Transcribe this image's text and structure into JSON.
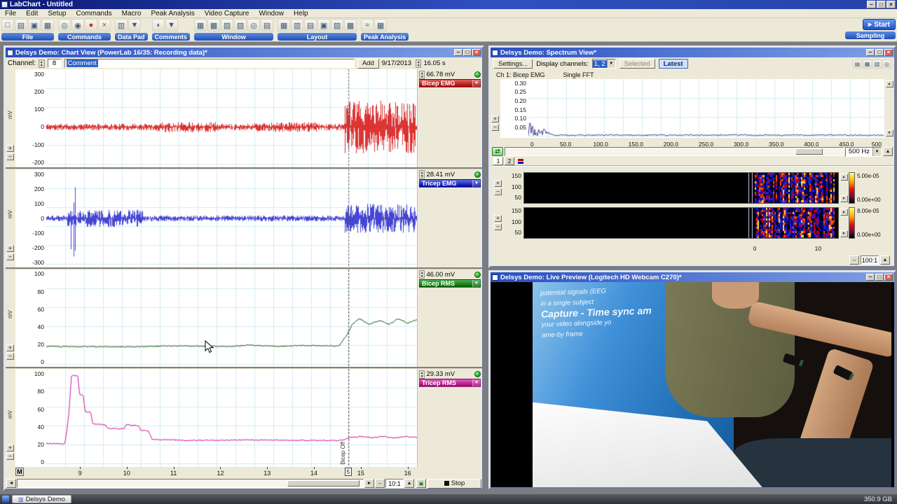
{
  "chrome": {
    "min": "–",
    "max": "□",
    "close": "×"
  },
  "glyphs": {
    "up": "▲",
    "down": "▼",
    "left": "◄",
    "right": "►",
    "both": "↔",
    "dropdown": "▼",
    "start": "▶",
    "refresh": "⇄",
    "screen": "▣"
  },
  "app": {
    "title": "LabChart - Untitled",
    "menus": [
      "File",
      "Edit",
      "Setup",
      "Commands",
      "Macro",
      "Peak Analysis",
      "Video Capture",
      "Window",
      "Help"
    ],
    "toolbar": {
      "groups": [
        {
          "label": "File",
          "icons": [
            "new-file-icon",
            "open-file-icon",
            "save-icon",
            "print-icon"
          ]
        },
        {
          "label": "Commands",
          "icons": [
            "find-icon",
            "zoom-icon",
            "macro-record-icon",
            "delete-icon"
          ]
        },
        {
          "label": "Data Pad",
          "icons": [
            "data-pad-icon",
            "dropdown-icon"
          ]
        },
        {
          "label": "Comments",
          "icons": [
            "comment-icon",
            "dropdown-icon"
          ]
        },
        {
          "label": "Window",
          "icons": [
            "tile-icon",
            "cascade-icon",
            "chart-view-icon",
            "xy-view-icon",
            "zoom-window-icon",
            "notebook-icon"
          ]
        },
        {
          "label": "Layout",
          "icons": [
            "layout-grid-icon",
            "add-row-icon",
            "add-col-icon",
            "merge-icon",
            "split-icon",
            "arrange-icon"
          ]
        },
        {
          "label": "Peak Analysis",
          "icons": [
            "peaks-icon",
            "table-icon"
          ]
        }
      ],
      "start_button": "Start",
      "sampling_label": "Sampling"
    }
  },
  "chart_window": {
    "title": "Delsys Demo: Chart View (PowerLab 16/35: Recording data)*",
    "channel_label": "Channel:",
    "channel_count": "8",
    "comment_text": "Comment",
    "add_button": "Add",
    "date": "9/17/2013",
    "time_value": "16.05 s",
    "marker_block": "M",
    "zoom_ratio": "10:1",
    "stop_button": "Stop",
    "x_axis": {
      "min": 8.28,
      "max": 16.2,
      "ticks": [
        9,
        10,
        11,
        12,
        13,
        14,
        15,
        16
      ]
    },
    "comment_marker": {
      "number": "5",
      "label": "Bicep Off",
      "time": 14.73
    },
    "y_units": [
      "mV",
      "mV",
      "mV",
      "mV"
    ],
    "y_labels": [
      [
        "300",
        "200",
        "100",
        "0",
        "-100",
        "-200"
      ],
      [
        "300",
        "200",
        "100",
        "0",
        "-100",
        "-200",
        "-300"
      ],
      [
        "100",
        "80",
        "60",
        "40",
        "20",
        "0"
      ],
      [
        "100",
        "80",
        "60",
        "40",
        "20",
        "0"
      ]
    ],
    "channels": [
      {
        "name": "Bicep EMG",
        "value": "66.78 mV",
        "bar_from": "#e06060",
        "bar_to": "#a00000"
      },
      {
        "name": "Tricep EMG",
        "value": "28.41 mV",
        "bar_from": "#6070e0",
        "bar_to": "#0000a0"
      },
      {
        "name": "Bicep RMS",
        "value": "46.00 mV",
        "bar_from": "#50b050",
        "bar_to": "#006000"
      },
      {
        "name": "Tricep RMS",
        "value": "29.33 mV",
        "bar_from": "#e05cc0",
        "bar_to": "#a0006c"
      }
    ],
    "signals": [
      {
        "kind": "emg",
        "color": "#d40000",
        "zero": 0.59,
        "base": 0.035,
        "bursts": [
          [
            0.3,
            0.46,
            0.055
          ],
          [
            0.56,
            0.74,
            0.05
          ],
          [
            0.805,
            0.995,
            0.27
          ]
        ]
      },
      {
        "kind": "emg",
        "color": "#1616c8",
        "zero": 0.5,
        "base": 0.03,
        "bursts": [
          [
            0.055,
            0.105,
            0.44
          ],
          [
            0.105,
            0.26,
            0.09
          ],
          [
            0.805,
            0.995,
            0.15
          ]
        ]
      },
      {
        "kind": "rms",
        "color": "#1e5c1e",
        "points": [
          [
            0,
            0.785
          ],
          [
            0.2,
            0.79
          ],
          [
            0.35,
            0.78
          ],
          [
            0.5,
            0.785
          ],
          [
            0.55,
            0.77
          ],
          [
            0.62,
            0.785
          ],
          [
            0.7,
            0.775
          ],
          [
            0.79,
            0.78
          ],
          [
            0.812,
            0.66
          ],
          [
            0.825,
            0.56
          ],
          [
            0.845,
            0.5
          ],
          [
            0.87,
            0.56
          ],
          [
            0.9,
            0.52
          ],
          [
            0.925,
            0.56
          ],
          [
            0.95,
            0.5
          ],
          [
            0.975,
            0.55
          ],
          [
            1,
            0.51
          ]
        ]
      },
      {
        "kind": "rms",
        "color": "#d4149c",
        "points": [
          [
            0,
            0.76
          ],
          [
            0.05,
            0.765
          ],
          [
            0.06,
            0.5
          ],
          [
            0.068,
            0.07
          ],
          [
            0.085,
            0.07
          ],
          [
            0.09,
            0.26
          ],
          [
            0.1,
            0.27
          ],
          [
            0.105,
            0.44
          ],
          [
            0.12,
            0.44
          ],
          [
            0.125,
            0.56
          ],
          [
            0.16,
            0.57
          ],
          [
            0.165,
            0.61
          ],
          [
            0.21,
            0.61
          ],
          [
            0.215,
            0.57
          ],
          [
            0.25,
            0.58
          ],
          [
            0.255,
            0.63
          ],
          [
            0.275,
            0.63
          ],
          [
            0.285,
            0.72
          ],
          [
            0.4,
            0.73
          ],
          [
            0.55,
            0.725
          ],
          [
            0.7,
            0.73
          ],
          [
            0.795,
            0.73
          ],
          [
            0.82,
            0.7
          ],
          [
            0.85,
            0.69
          ],
          [
            0.88,
            0.705
          ],
          [
            0.91,
            0.69
          ],
          [
            0.94,
            0.705
          ],
          [
            0.97,
            0.69
          ],
          [
            1,
            0.7
          ]
        ]
      }
    ]
  },
  "spectrum_window": {
    "title": "Delsys Demo: Spectrum View*",
    "settings_button": "Settings...",
    "display_channels_label": "Display channels:",
    "display_channels_value": "1, 2",
    "selected_button": "Selected",
    "latest_button": "Latest",
    "channel_title": "Ch 1: Bicep EMG",
    "mode": "Single FFT",
    "fft_y_ticks": [
      "0.30",
      "0.25",
      "0.20",
      "0.15",
      "0.10",
      "0.05"
    ],
    "fft_x_ticks": [
      "0",
      "50.0",
      "100.0",
      "150.0",
      "200.0",
      "250.0",
      "300.0",
      "350.0",
      "400.0",
      "450.0",
      "500"
    ],
    "freq_range": "500 Hz",
    "tabs": [
      "1",
      "2"
    ],
    "legend_colors": [
      "#c00000",
      "#0000c0"
    ],
    "spectrograms": [
      {
        "y_ticks": [
          "150",
          "100",
          "50"
        ],
        "scale_max": "5.00e-05",
        "scale_min": "0.00e+00"
      },
      {
        "y_ticks": [
          "150",
          "100",
          "50"
        ],
        "scale_max": "8.00e-05",
        "scale_min": "0.00e+00"
      }
    ],
    "spec_x_ticks": [
      {
        "label": "0",
        "frac": 0.73
      },
      {
        "label": "10",
        "frac": 0.93
      }
    ],
    "zoom_ratio": "100:1"
  },
  "video_window": {
    "title": "Delsys Demo: Live Preview (Logitech HD Webcam C270)*",
    "banner_lines": [
      "potential signals (EEG",
      "in a single subject",
      "Capture - Time sync am",
      "your video alongside yo",
      "ame-by frame"
    ]
  },
  "taskbar": {
    "item_label": "Delsys Demo",
    "disk_space": "350.9 GB"
  }
}
